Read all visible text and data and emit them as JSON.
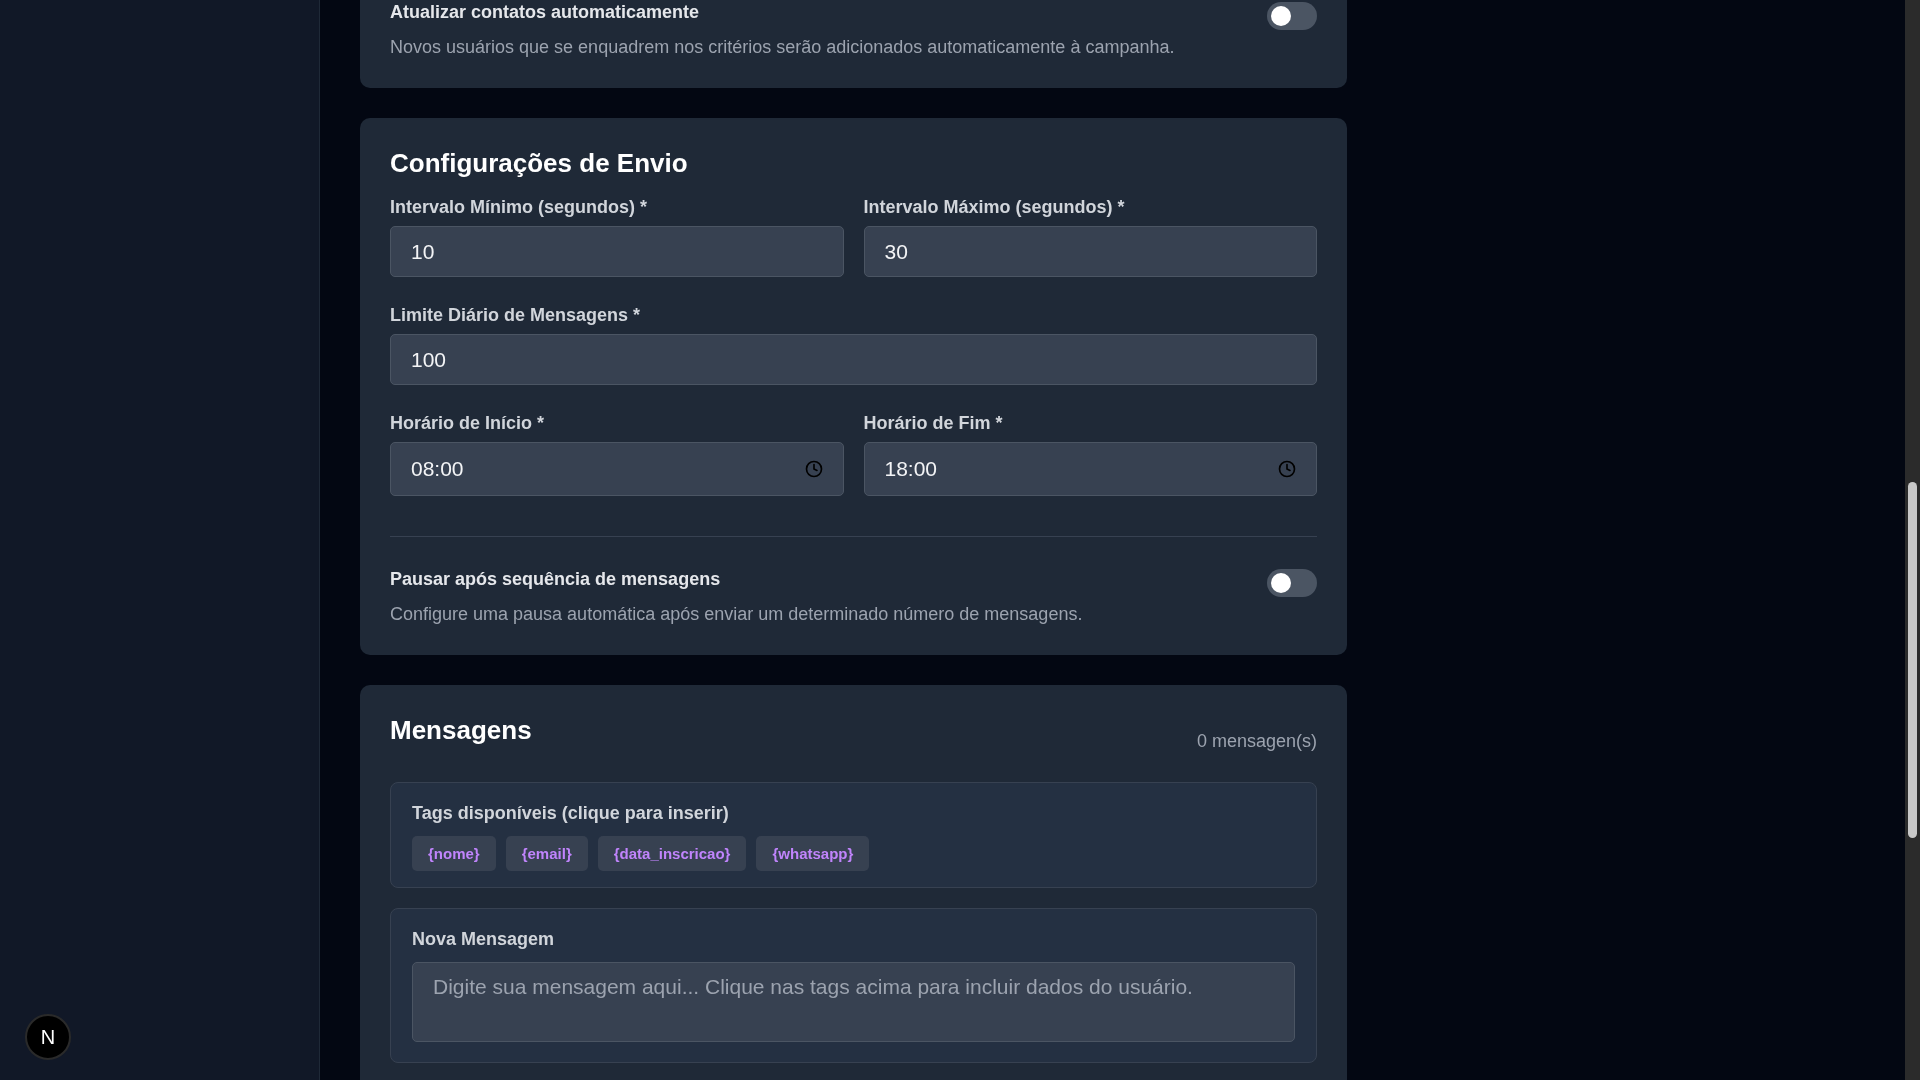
{
  "auto_update": {
    "label": "Atualizar contatos automaticamente",
    "description": "Novos usuários que se enquadrem nos critérios serão adicionados automaticamente à campanha.",
    "on": false
  },
  "send_settings": {
    "title": "Configurações de Envio",
    "field_rows": [
      [
        {
          "kind": "number",
          "label": "Intervalo Mínimo (segundos) *",
          "value": "10"
        },
        {
          "kind": "number",
          "label": "Intervalo Máximo (segundos) *",
          "value": "30"
        }
      ],
      [
        {
          "kind": "number",
          "label": "Limite Diário de Mensagens *",
          "value": "100"
        }
      ],
      [
        {
          "kind": "time",
          "label": "Horário de Início *",
          "value": "08:00"
        },
        {
          "kind": "time",
          "label": "Horário de Fim *",
          "value": "18:00"
        }
      ]
    ],
    "pause": {
      "label": "Pausar após sequência de mensagens",
      "description": "Configure uma pausa automática após enviar um determinado número de mensagens.",
      "on": false
    }
  },
  "messages": {
    "title": "Mensagens",
    "count": "0 mensagen(s)",
    "tags_title": "Tags disponíveis (clique para inserir)",
    "tags": [
      "{nome}",
      "{email}",
      "{data_inscricao}",
      "{whatsapp}"
    ],
    "new_message": {
      "label": "Nova Mensagem",
      "placeholder": "Digite sua mensagem aqui... Clique nas tags acima para incluir dados do usuário."
    }
  },
  "dev_badge": {
    "label": "N"
  }
}
